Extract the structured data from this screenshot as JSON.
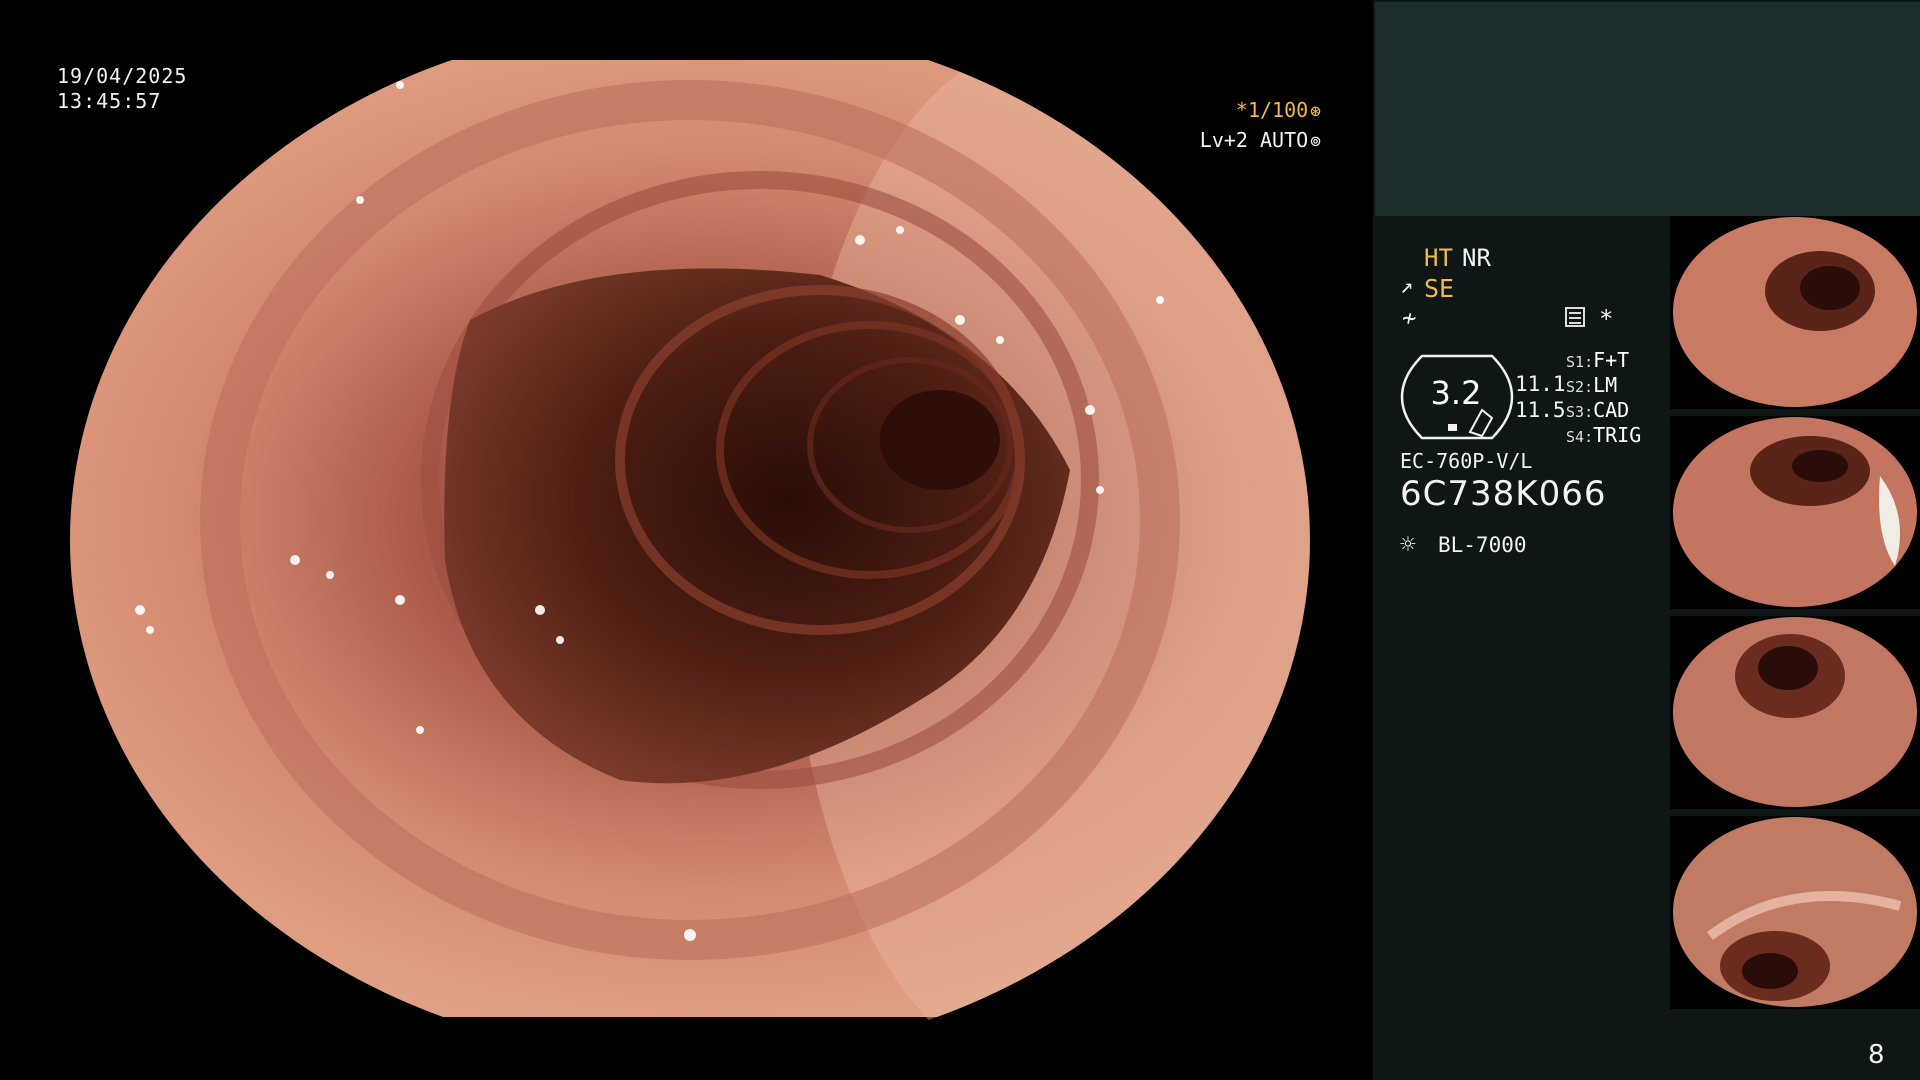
{
  "overlay": {
    "date": "19/04/2025",
    "time": "13:45:57",
    "shutter": "*1/100",
    "shutter_icon": "aperture-icon",
    "level": "Lv+2 AUTO",
    "level_icon": "iris-icon"
  },
  "panel": {
    "ht": "HT",
    "nr": "NR",
    "se": "SE",
    "zoom": "3.2",
    "enhance_a": "11.1",
    "enhance_b": "11.5",
    "switches": [
      {
        "key": "S1",
        "value": "F+T"
      },
      {
        "key": "S2",
        "value": "LM"
      },
      {
        "key": "S3",
        "value": "CAD"
      },
      {
        "key": "S4",
        "value": "TRIG"
      }
    ],
    "scope_model": "EC-760P-V/L",
    "scope_serial": "6C738K066",
    "light_source": "BL-7000",
    "page_number": "8"
  },
  "thumbnails": [
    {
      "name": "capture-1"
    },
    {
      "name": "capture-2"
    },
    {
      "name": "capture-3"
    },
    {
      "name": "capture-4"
    }
  ],
  "colors": {
    "accent": "#f1b84b",
    "panel_bg": "#0f1716",
    "top_band": "#1b2e2b",
    "mucosa": "#c97a63",
    "lumen": "#3b1710"
  }
}
